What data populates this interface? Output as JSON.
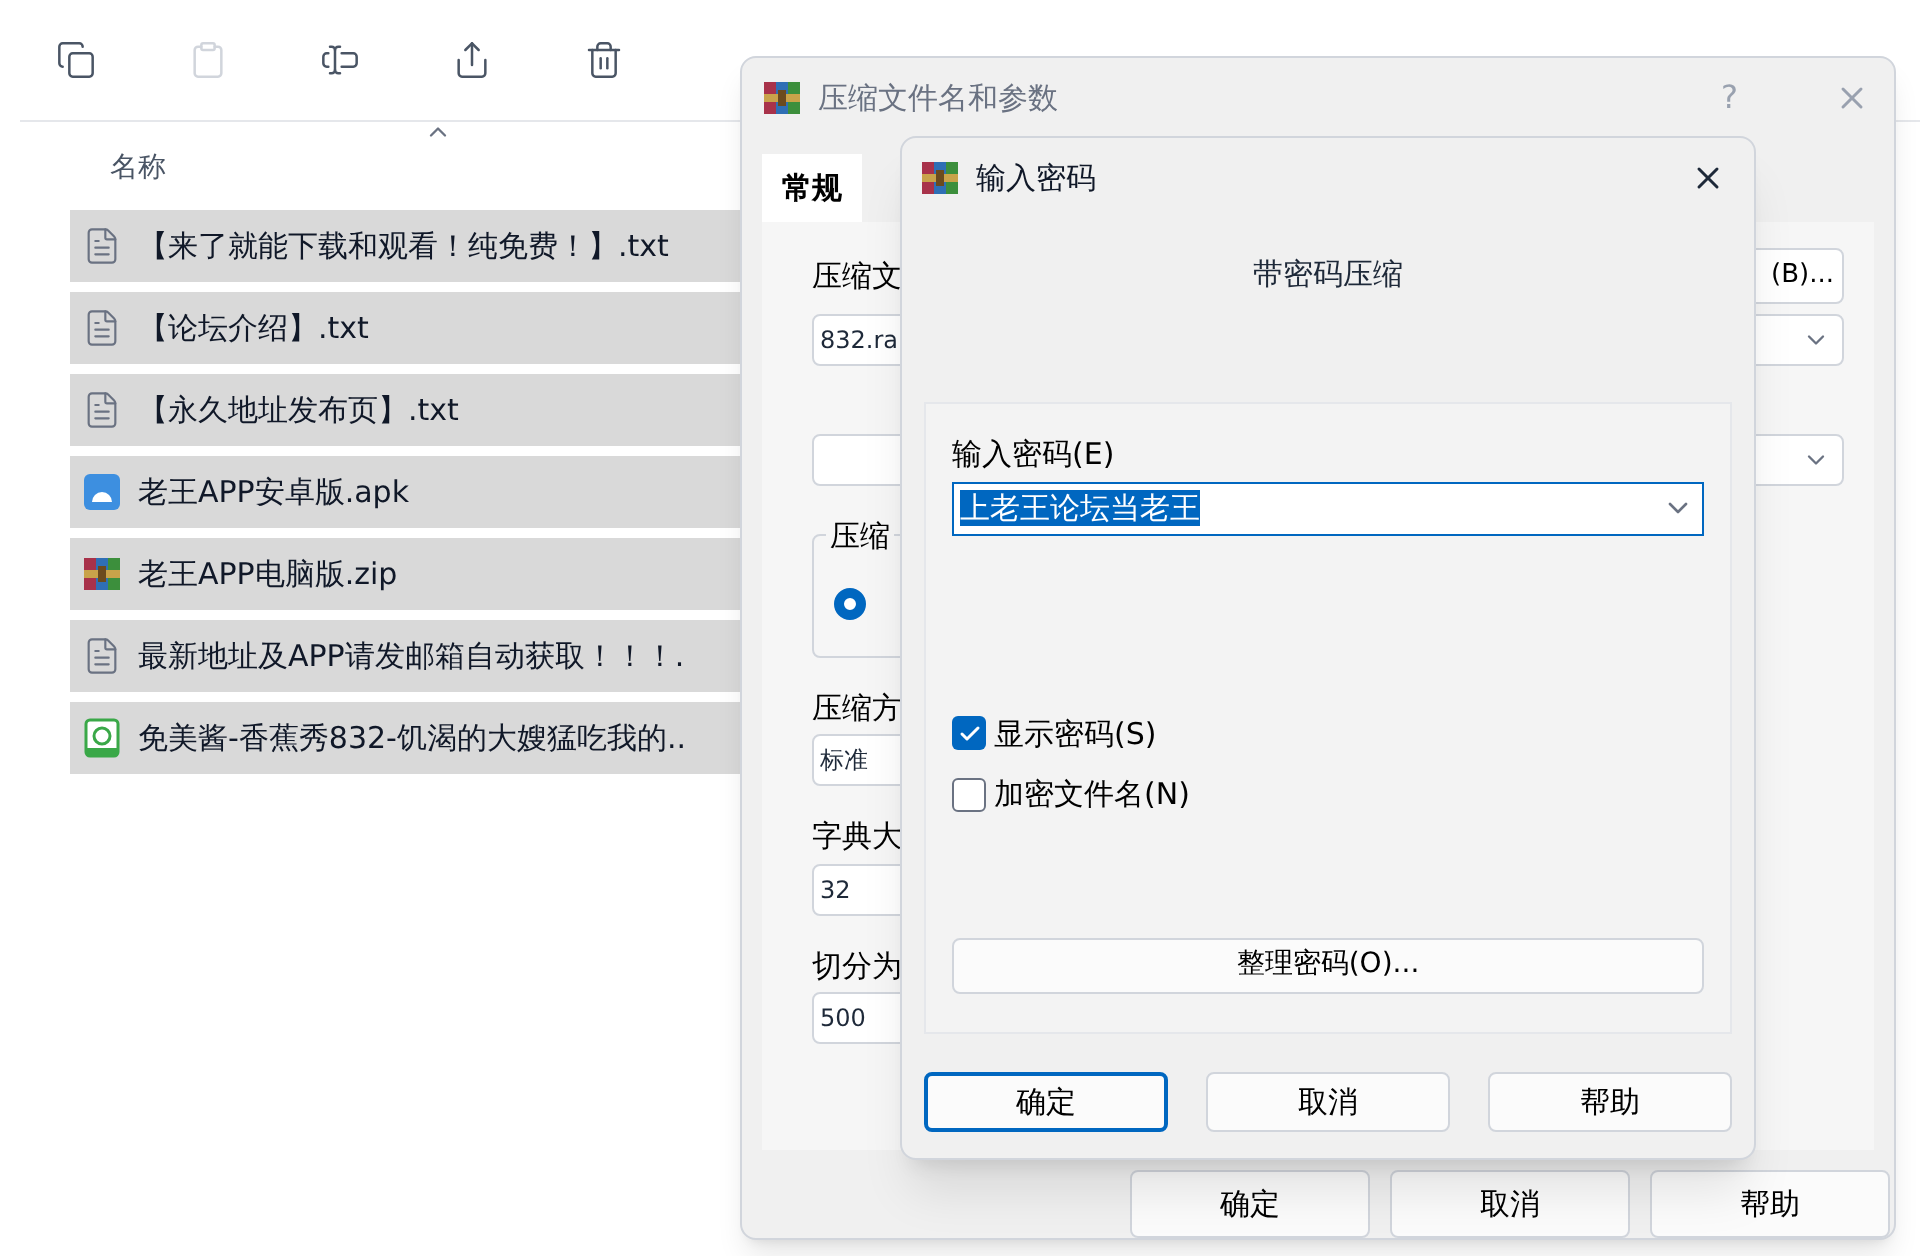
{
  "toolbar": {
    "buttons": [
      {
        "kind": "copy",
        "disabled": false
      },
      {
        "kind": "paste",
        "disabled": true
      },
      {
        "kind": "rename",
        "disabled": false
      },
      {
        "kind": "share",
        "disabled": false
      },
      {
        "kind": "delete",
        "disabled": false
      }
    ]
  },
  "file_list": {
    "column_header": "名称",
    "files": [
      {
        "name": "【来了就能下载和观看！纯免费！】.txt",
        "kind": "txt",
        "selected": true
      },
      {
        "name": "【论坛介绍】.txt",
        "kind": "txt",
        "selected": true
      },
      {
        "name": "【永久地址发布页】.txt",
        "kind": "txt",
        "selected": true
      },
      {
        "name": "老王APP安卓版.apk",
        "kind": "apk",
        "selected": true
      },
      {
        "name": "老王APP电脑版.zip",
        "kind": "zip",
        "selected": true
      },
      {
        "name": "最新地址及APP请发邮箱自动获取！！！.",
        "kind": "txt",
        "selected": true
      },
      {
        "name": "免美酱-香蕉秀832-饥渴的大嫂猛吃我的..",
        "kind": "video",
        "selected": true
      }
    ]
  },
  "archive_dialog": {
    "title": "压缩文件名和参数",
    "help_glyph": "?",
    "tabs": [
      {
        "label": "常规",
        "selected": true
      }
    ],
    "archive_label": "压缩文",
    "browse_button": "(B)...",
    "archive_name": "832.ra",
    "group_label": "压缩",
    "radio_selected": true,
    "method_label": "压缩方",
    "method_value": "标准",
    "dict_label": "字典大",
    "dict_value": "32",
    "split_label": "切分为",
    "split_value": "500",
    "buttons": [
      "确定",
      "取消",
      "帮助"
    ]
  },
  "password_dialog": {
    "title": "输入密码",
    "heading": "带密码压缩",
    "password_label": "输入密码(E)",
    "password_value": "上老王论坛当老王",
    "password_selected": true,
    "options": [
      {
        "label": "显示密码(S)",
        "checked": true
      },
      {
        "label": "加密文件名(N)",
        "checked": false
      }
    ],
    "organize_button": "整理密码(O)...",
    "buttons": [
      {
        "label": "确定",
        "default": true
      },
      {
        "label": "取消",
        "default": false
      },
      {
        "label": "帮助",
        "default": false
      }
    ]
  }
}
